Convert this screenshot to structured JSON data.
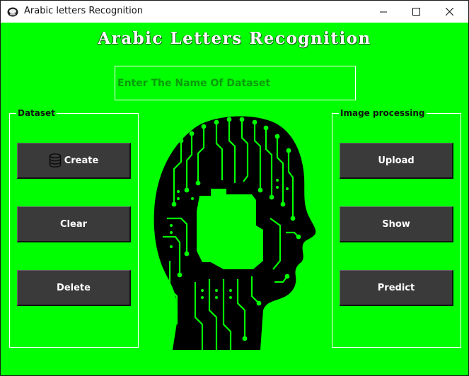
{
  "window": {
    "title": "Arabic letters Recognition",
    "icon": "app-logo-icon",
    "controls": [
      "minimize-icon",
      "maximize-icon",
      "close-icon"
    ]
  },
  "header": {
    "title": "Arabic Letters Recognition"
  },
  "dataset_name": {
    "placeholder": "Enter The Name Of Dataset",
    "value": ""
  },
  "dataset_panel": {
    "label": "Dataset",
    "buttons": [
      {
        "label": "Create",
        "icon": "database-icon"
      },
      {
        "label": "Clear"
      },
      {
        "label": "Delete"
      }
    ]
  },
  "image_panel": {
    "label": "Image processing",
    "buttons": [
      {
        "label": "Upload"
      },
      {
        "label": "Show"
      },
      {
        "label": "Predict"
      }
    ]
  },
  "illustration": {
    "icon": "circuit-head-icon"
  },
  "colors": {
    "background": "#00ff00",
    "button": "#3a3a3a",
    "button_text": "#ffffff",
    "frame_border": "#ffffff",
    "art": "#000000"
  }
}
